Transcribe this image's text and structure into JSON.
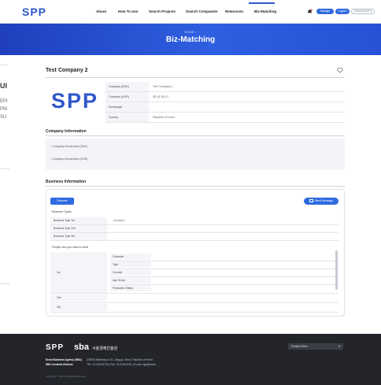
{
  "header": {
    "logo": "SPP",
    "nav": [
      "About",
      "How To Use",
      "Search Projects",
      "Search Companies",
      "Newsroom",
      "Biz-Matching"
    ],
    "manage_label": "Manage",
    "logout_label": "Logout",
    "language_label": "LANGUAGE ▾"
  },
  "hero": {
    "crumb": "HOME >",
    "title": "Biz-Matching"
  },
  "side_fragments": [
    "UI",
    "EPI",
    "PM",
    "SU"
  ],
  "company": {
    "name": "Test Company 2",
    "logo": "SPP",
    "info": [
      {
        "label": "Company (ENG)",
        "value": "Test Company 2"
      },
      {
        "label": "Company (KOR)",
        "value": "테스트 회사 2"
      },
      {
        "label": "Homepage",
        "value": ""
      },
      {
        "label": "Country",
        "value": "Republic of Korea"
      }
    ]
  },
  "company_information": {
    "title": "Company Information",
    "items": [
      "Company Introduction (ENG)",
      "Company Introduction (KOR)"
    ]
  },
  "business_information": {
    "title": "Business Information",
    "request_label": "Request",
    "send_message_label": "Send Message",
    "business_types_label": "Business Types",
    "business_types": [
      {
        "key": "Business Type 1st",
        "value": "Animation"
      },
      {
        "key": "Business Type 2nd",
        "value": ""
      },
      {
        "key": "Business Type 3rd",
        "value": ""
      }
    ],
    "people_label": "People who you want to meet",
    "people_rows": [
      "1st",
      "2nd",
      "3rd"
    ],
    "people_fields": [
      "Character",
      "Type",
      "Concept",
      "Age Group",
      "Production Status"
    ]
  },
  "footer": {
    "logo": "SPP",
    "sba": "sba",
    "sba_kr": "서울경제진흥원",
    "select_label": "Related Sites",
    "agency_label": "Seoul Business Agency (SBA)",
    "contents_label": "SBA Contents Division",
    "agency_text": "(03925) Maebong-ro 31, Jung-gu, Seoul, Republic of Korea",
    "contents_text": "TEL. 02-3149-8700  |  FAX. 02-3149-8701  |  E-mail. spp@sba.kr",
    "copyright": "Copyright © SBA. All Rights Reserved."
  },
  "colors": {
    "brand": "#2f57c9",
    "button": "#2f6be0",
    "footer": "#23252b"
  }
}
